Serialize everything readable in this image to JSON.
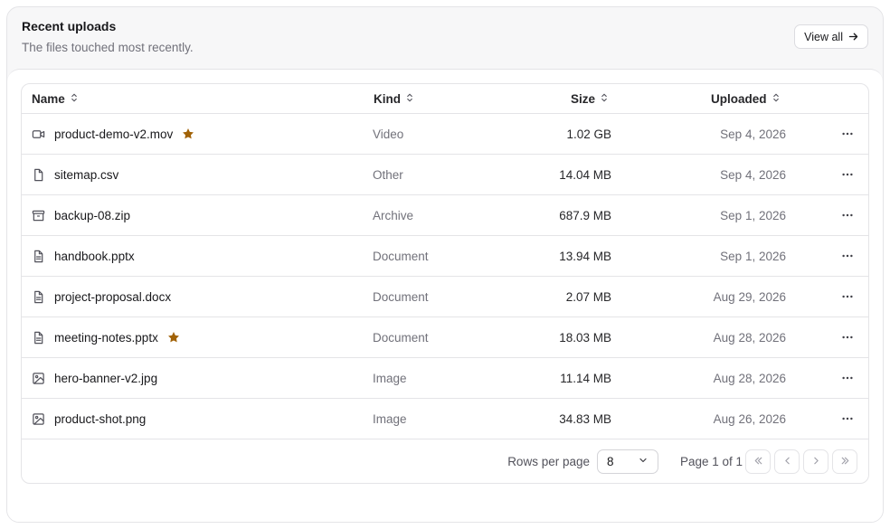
{
  "header": {
    "title": "Recent uploads",
    "subtitle": "The files touched most recently.",
    "view_all_label": "View all"
  },
  "table": {
    "columns": {
      "name": "Name",
      "kind": "Kind",
      "size": "Size",
      "uploaded": "Uploaded"
    },
    "rows": [
      {
        "name": "product-demo-v2.mov",
        "kind": "Video",
        "size": "1.02 GB",
        "uploaded": "Sep 4, 2026",
        "icon": "video-icon",
        "starred": true
      },
      {
        "name": "sitemap.csv",
        "kind": "Other",
        "size": "14.04 MB",
        "uploaded": "Sep 4, 2026",
        "icon": "file-icon",
        "starred": false
      },
      {
        "name": "backup-08.zip",
        "kind": "Archive",
        "size": "687.9 MB",
        "uploaded": "Sep 1, 2026",
        "icon": "archive-icon",
        "starred": false
      },
      {
        "name": "handbook.pptx",
        "kind": "Document",
        "size": "13.94 MB",
        "uploaded": "Sep 1, 2026",
        "icon": "document-icon",
        "starred": false
      },
      {
        "name": "project-proposal.docx",
        "kind": "Document",
        "size": "2.07 MB",
        "uploaded": "Aug 29, 2026",
        "icon": "document-icon",
        "starred": false
      },
      {
        "name": "meeting-notes.pptx",
        "kind": "Document",
        "size": "18.03 MB",
        "uploaded": "Aug 28, 2026",
        "icon": "document-icon",
        "starred": true
      },
      {
        "name": "hero-banner-v2.jpg",
        "kind": "Image",
        "size": "11.14 MB",
        "uploaded": "Aug 28, 2026",
        "icon": "image-icon",
        "starred": false
      },
      {
        "name": "product-shot.png",
        "kind": "Image",
        "size": "34.83 MB",
        "uploaded": "Aug 26, 2026",
        "icon": "image-icon",
        "starred": false
      }
    ]
  },
  "footer": {
    "rows_per_page_label": "Rows per page",
    "rows_per_page_value": "8",
    "page_label": "Page 1 of 1"
  },
  "colors": {
    "star": "#a16207",
    "border": "#e4e4e7",
    "muted_text": "#71717a",
    "header_bg": "#f7f7f8"
  }
}
